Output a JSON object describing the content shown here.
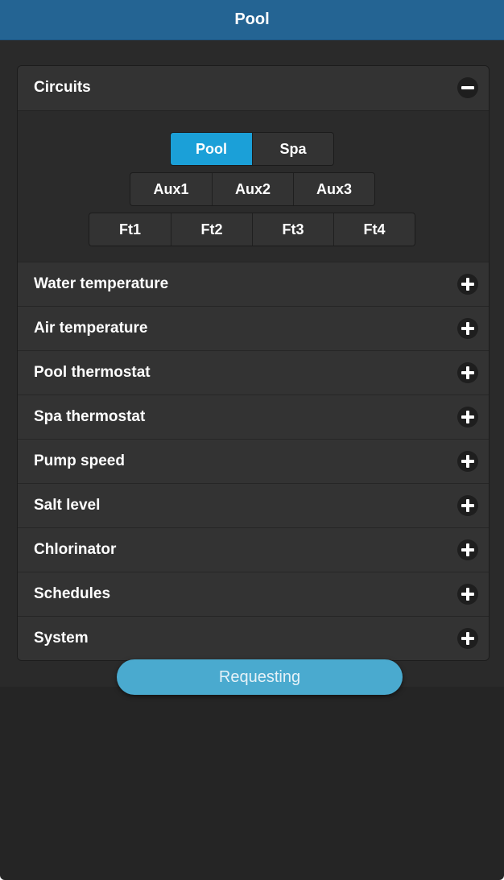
{
  "header": {
    "title": "Pool"
  },
  "circuits": {
    "title": "Circuits",
    "rows": [
      [
        "Pool",
        "Spa"
      ],
      [
        "Aux1",
        "Aux2",
        "Aux3"
      ],
      [
        "Ft1",
        "Ft2",
        "Ft3",
        "Ft4"
      ]
    ],
    "active": "Pool"
  },
  "sections": [
    "Water temperature",
    "Air temperature",
    "Pool thermostat",
    "Spa thermostat",
    "Pump speed",
    "Salt level",
    "Chlorinator",
    "Schedules",
    "System"
  ],
  "status": {
    "text": "Requesting"
  },
  "colors": {
    "header_bg": "#246493",
    "active_button": "#1ba0d8",
    "status_pill": "#4aaacf"
  },
  "icons": {
    "expanded": "minus-icon",
    "collapsed": "plus-icon"
  }
}
